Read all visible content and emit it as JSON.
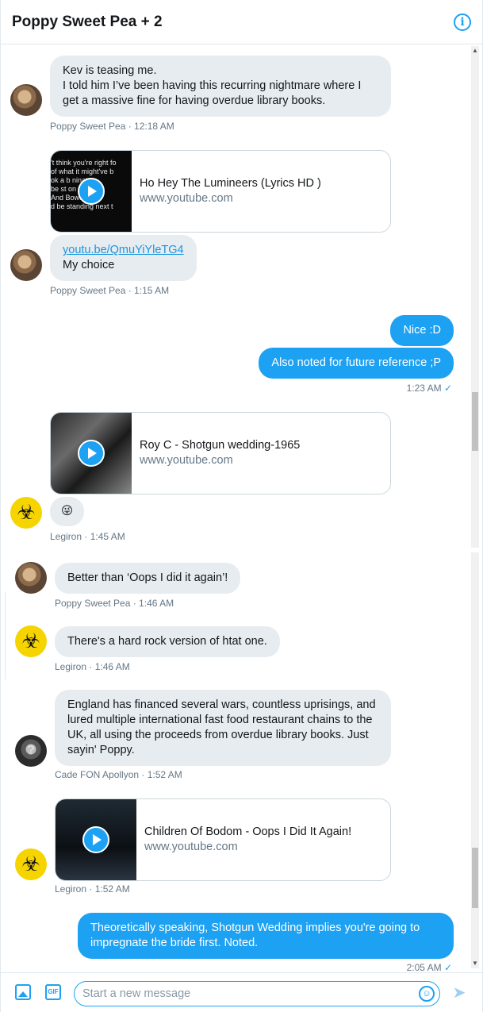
{
  "header": {
    "title": "Poppy Sweet Pea + 2",
    "info_icon": "info-icon"
  },
  "messages": {
    "m1": {
      "text": "Kev is teasing me.\nI told him I’ve been having this recurring nightmare where I get a massive fine for having overdue library books.",
      "meta": "Poppy Sweet Pea · 12:18 AM"
    },
    "card1": {
      "title": "Ho Hey The Lumineers (Lyrics HD )",
      "domain": "www.youtube.com",
      "thumb_text": [
        "'t think you're right fo",
        "of what it might've b",
        "ok a b        ninato",
        "be st        on can",
        "   And Bowery...",
        "d be standing next t"
      ]
    },
    "m2": {
      "link": "youtu.be/QmuYiYleTG4",
      "text": "My choice",
      "meta": "Poppy Sweet Pea · 1:15 AM"
    },
    "m3": {
      "text": "Nice :D"
    },
    "m4": {
      "text": "Also noted for future reference ;P",
      "meta": "1:23 AM",
      "check": "✓"
    },
    "card2": {
      "title": "Roy C - Shotgun wedding-1965",
      "domain": "www.youtube.com"
    },
    "m5": {
      "text": "😜",
      "meta": "Legiron · 1:45 AM"
    },
    "m6": {
      "text": "Better than ‘Oops I did it again’!",
      "meta": "Poppy Sweet Pea · 1:46 AM"
    },
    "m7": {
      "text": "There's a hard rock version of htat one.",
      "meta": "Legiron · 1:46 AM"
    },
    "m8": {
      "text": "England has financed several wars, countless uprisings, and lured multiple international fast food restaurant chains to the UK, all using the proceeds from overdue library books. Just sayin' Poppy.",
      "meta": "Cade FON Apollyon · 1:52 AM"
    },
    "card3": {
      "title": "Children Of Bodom - Oops I Did It Again!",
      "domain": "www.youtube.com"
    },
    "m9": {
      "meta": "Legiron · 1:52 AM"
    },
    "m10": {
      "text": "Theoretically speaking, Shotgun Wedding implies you're going to impregnate the bride first. Noted.",
      "meta": "2:05 AM",
      "check": "✓"
    }
  },
  "composer": {
    "placeholder": "Start a new message",
    "gif_label": "GIF",
    "emoji_glyph": "☺",
    "send_glyph": "➤"
  },
  "colors": {
    "accent": "#1da1f2",
    "incoming_bubble": "#e6ecf0",
    "meta_text": "#657786"
  }
}
